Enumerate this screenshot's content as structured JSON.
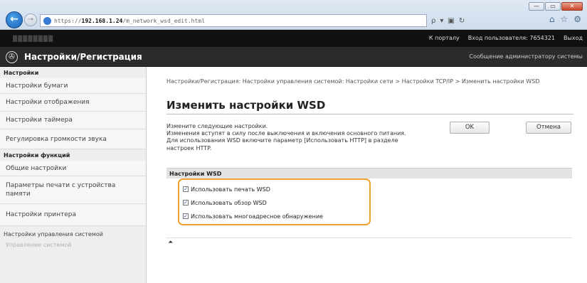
{
  "browser": {
    "url_prefix": "https://",
    "url_host": "192.168.1.24",
    "url_path": "/m_network_wsd_edit.html",
    "search_glyph": "ρ",
    "window_controls": [
      "—",
      "▭",
      "✕"
    ]
  },
  "topbar": {
    "portal_link": "К порталу",
    "user_label": "Вход пользователя:",
    "user_id": "7654321",
    "logout_link": "Выход"
  },
  "titlebar": {
    "app_title": "Настройки/Регистрация",
    "admin_message_link": "Сообщение администратору системы"
  },
  "sidebar": {
    "section_settings": "Настройки",
    "items_settings": [
      "Настройки бумаги",
      "Настройки отображения",
      "Настройки таймера",
      "Регулировка громкости звука"
    ],
    "section_functions": "Настройки функций",
    "items_functions": [
      "Общие настройки",
      "Параметры печати с устройства памяти",
      "Настройки принтера"
    ],
    "section_system": "Настройки управления системой",
    "faded_item": "Управление системой"
  },
  "main": {
    "breadcrumb": "Настройки/Регистрация: Настройки управления системой: Настройки сети > Настройки TCP/IP > Изменить настройки WSD",
    "page_title": "Изменить настройки WSD",
    "description_lines": [
      "Измените следующие настройки.",
      "Изменения вступят в силу после выключения и включения основного питания.",
      "Для использования WSD включите параметр [Использовать HTTP] в разделе",
      "настроек HTTP."
    ],
    "ok_button": "OK",
    "cancel_button": "Отмена",
    "section_title": "Настройки WSD",
    "options": [
      {
        "label": "Использовать печать WSD",
        "checked": true
      },
      {
        "label": "Использовать обзор WSD",
        "checked": true
      },
      {
        "label": "Использовать многоадресное обнаружение",
        "checked": true
      }
    ],
    "to_top_glyph": "⏶"
  },
  "colors": {
    "highlight": "#f0a030",
    "topbar": "#101010",
    "titlebar": "#2b2b2b",
    "back_button": "#1a5fb4"
  }
}
